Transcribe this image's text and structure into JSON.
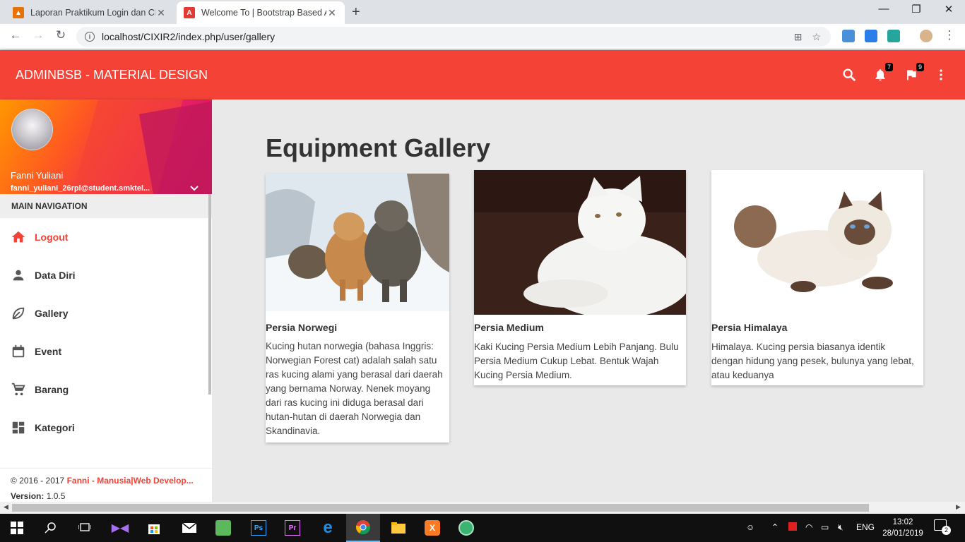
{
  "browser": {
    "tabs": [
      {
        "title": "Laporan Praktikum Login dan CR",
        "favicon_color": "#e8710a",
        "active": false
      },
      {
        "title": "Welcome To | Bootstrap Based A",
        "favicon_color": "#e53935",
        "favicon_letter": "A",
        "active": true
      }
    ],
    "url": "localhost/CIXIR2/index.php/user/gallery"
  },
  "app": {
    "brand": "ADMINBSB - MATERIAL DESIGN",
    "notifications_count": "7",
    "tasks_count": "9",
    "accent_color": "#f44336"
  },
  "user": {
    "name": "Fanni Yuliani",
    "email": "fanni_yuliani_26rpl@student.smktel..."
  },
  "nav": {
    "header": "MAIN NAVIGATION",
    "items": [
      {
        "label": "Logout",
        "icon": "home-icon",
        "active": true
      },
      {
        "label": "Data Diri",
        "icon": "person-icon",
        "active": false
      },
      {
        "label": "Gallery",
        "icon": "leaf-icon",
        "active": false
      },
      {
        "label": "Event",
        "icon": "calendar-icon",
        "active": false
      },
      {
        "label": "Barang",
        "icon": "cart-icon",
        "active": false
      },
      {
        "label": "Kategori",
        "icon": "dashboard-icon",
        "active": false
      }
    ]
  },
  "footer": {
    "copyright_prefix": "© 2016 - 2017 ",
    "copyright_link": "Fanni - Manusia|Web Develop...",
    "version_label": "Version: ",
    "version_value": "1.0.5"
  },
  "page": {
    "title": "Equipment Gallery"
  },
  "gallery": [
    {
      "title": "Persia Norwegi",
      "description": "Kucing hutan norwegia (bahasa Inggris: Norwegian Forest cat) adalah salah satu ras kucing alami yang berasal dari daerah yang bernama Norway. Nenek moyang dari ras kucing ini diduga berasal dari hutan-hutan di daerah Norwegia dan Skandinavia."
    },
    {
      "title": "Persia Medium",
      "description": "Kaki Kucing Persia Medium Lebih Panjang. Bulu Persia Medium Cukup Lebat. Bentuk Wajah Kucing Persia Medium."
    },
    {
      "title": "Persia Himalaya",
      "description": "Himalaya. Kucing persia biasanya identik dengan hidung yang pesek, bulunya yang lebat, atau keduanya"
    }
  ],
  "taskbar": {
    "language": "ENG",
    "time": "13:02",
    "date": "28/01/2019",
    "notifications": "2"
  }
}
